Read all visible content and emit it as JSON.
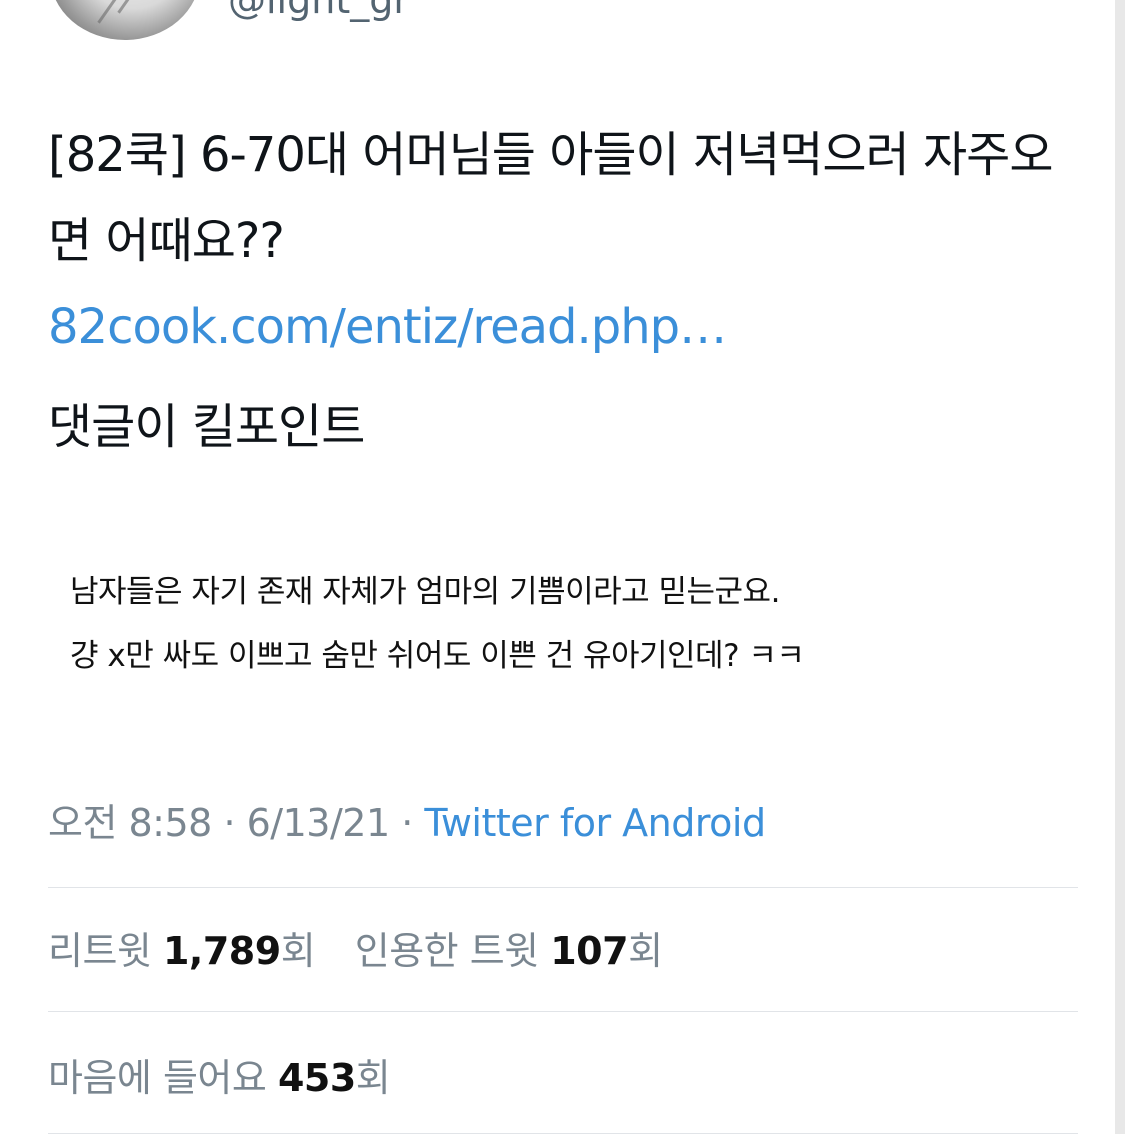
{
  "user": {
    "handle": "@light_gr"
  },
  "tweet": {
    "text": "[82쿡] 6-70대 어머님들 아들이 저녁먹으러 자주오면 어때요??",
    "link": "82cook.com/entiz/read.php…",
    "extra": "댓글이 킬포인트"
  },
  "quoted_image": {
    "lines": [
      "남자들은 자기 존재 자체가 엄마의 기쁨이라고 믿는군요.",
      "걍 x만 싸도 이쁘고 숨만 쉬어도 이쁜 건 유아기인데? ㅋㅋ"
    ]
  },
  "meta": {
    "time": "오전 8:58",
    "date": "6/13/21",
    "separator": "·",
    "source": "Twitter for Android"
  },
  "stats": {
    "retweets_label": "리트윗",
    "retweets_count": "1,789",
    "retweets_unit": "회",
    "quotes_label": "인용한 트윗",
    "quotes_count": "107",
    "quotes_unit": "회",
    "likes_label": "마음에 들어요",
    "likes_count": "453",
    "likes_unit": "회"
  },
  "colors": {
    "link": "#3b8fd9",
    "muted": "#7a8690",
    "divider": "#e1e4e8"
  }
}
